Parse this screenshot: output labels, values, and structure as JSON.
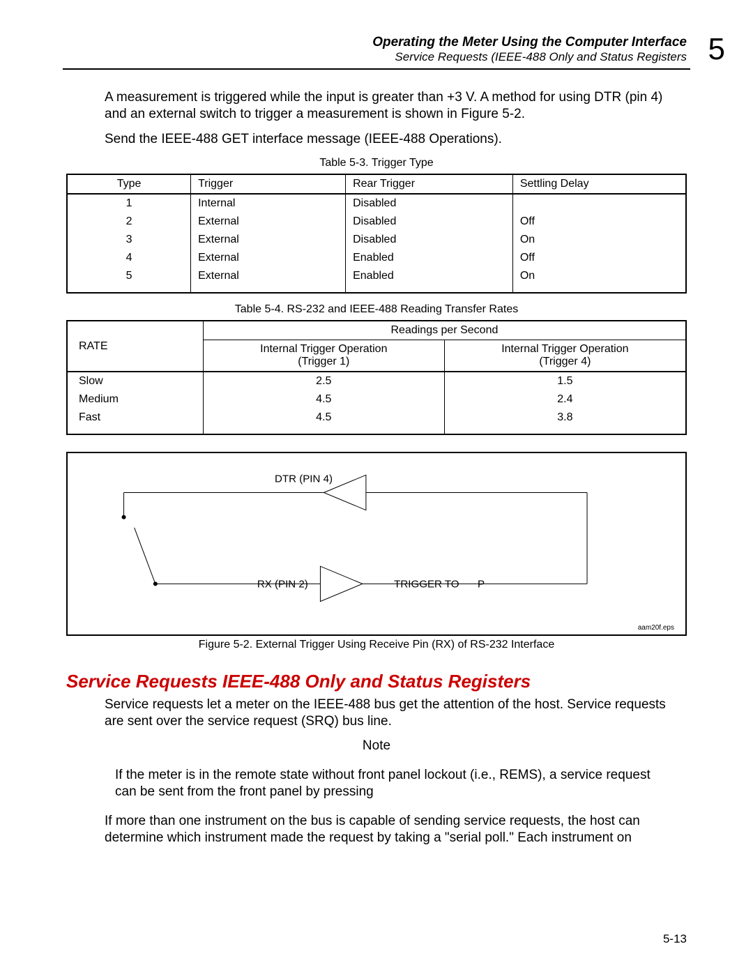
{
  "header": {
    "title": "Operating the Meter Using the Computer Interface",
    "subtitle": "Service Requests (IEEE-488 Only and Status Registers",
    "chapter": "5"
  },
  "paragraphs": {
    "p1": "A measurement is triggered while the input is greater than +3 V. A method for using DTR (pin 4) and an external switch to trigger a measurement is shown in Figure 5-2.",
    "p2": "Send the IEEE-488 GET interface message (IEEE-488 Operations).",
    "p3": "Service requests let a meter on the IEEE-488 bus get the attention of the host. Service requests are sent over the service request (SRQ) bus line.",
    "p4_note": "If the meter is in the remote state without front panel lockout (i.e., REMS), a service request can be sent from the front panel by pressing",
    "p5": "If more than one instrument on the bus is capable of sending service requests, the host can determine which instrument made the request by taking a \"serial poll.\" Each instrument on"
  },
  "table1": {
    "caption": "Table 5-3. Trigger Type",
    "headers": [
      "Type",
      "Trigger",
      "Rear Trigger",
      "Settling Delay"
    ],
    "rows": [
      [
        "1",
        "Internal",
        "Disabled",
        ""
      ],
      [
        "2",
        "External",
        "Disabled",
        "Off"
      ],
      [
        "3",
        "External",
        "Disabled",
        "On"
      ],
      [
        "4",
        "External",
        "Enabled",
        "Off"
      ],
      [
        "5",
        "External",
        "Enabled",
        "On"
      ]
    ]
  },
  "table2": {
    "caption": "Table 5-4. RS-232 and IEEE-488 Reading Transfer Rates",
    "rate_label": "RATE",
    "super_header": "Readings per Second",
    "sub_headers": [
      {
        "line1": "Internal Trigger Operation",
        "line2": "(Trigger 1)"
      },
      {
        "line1": "Internal Trigger Operation",
        "line2": "(Trigger 4)"
      }
    ],
    "rows": [
      [
        "Slow",
        "2.5",
        "1.5"
      ],
      [
        "Medium",
        "4.5",
        "2.4"
      ],
      [
        "Fast",
        "4.5",
        "3.8"
      ]
    ]
  },
  "figure": {
    "labels": {
      "dtr": "DTR (PIN 4)",
      "rx": "RX (PIN 2)",
      "trigger": "TRIGGER TO",
      "trigger_suffix": "P"
    },
    "eps": "aam20f.eps",
    "caption": "Figure 5-2. External Trigger Using Receive Pin (RX) of RS-232 Interface"
  },
  "section_heading": "Service Requests IEEE-488 Only and Status Registers",
  "note_label": "Note",
  "page_number": "5-13"
}
